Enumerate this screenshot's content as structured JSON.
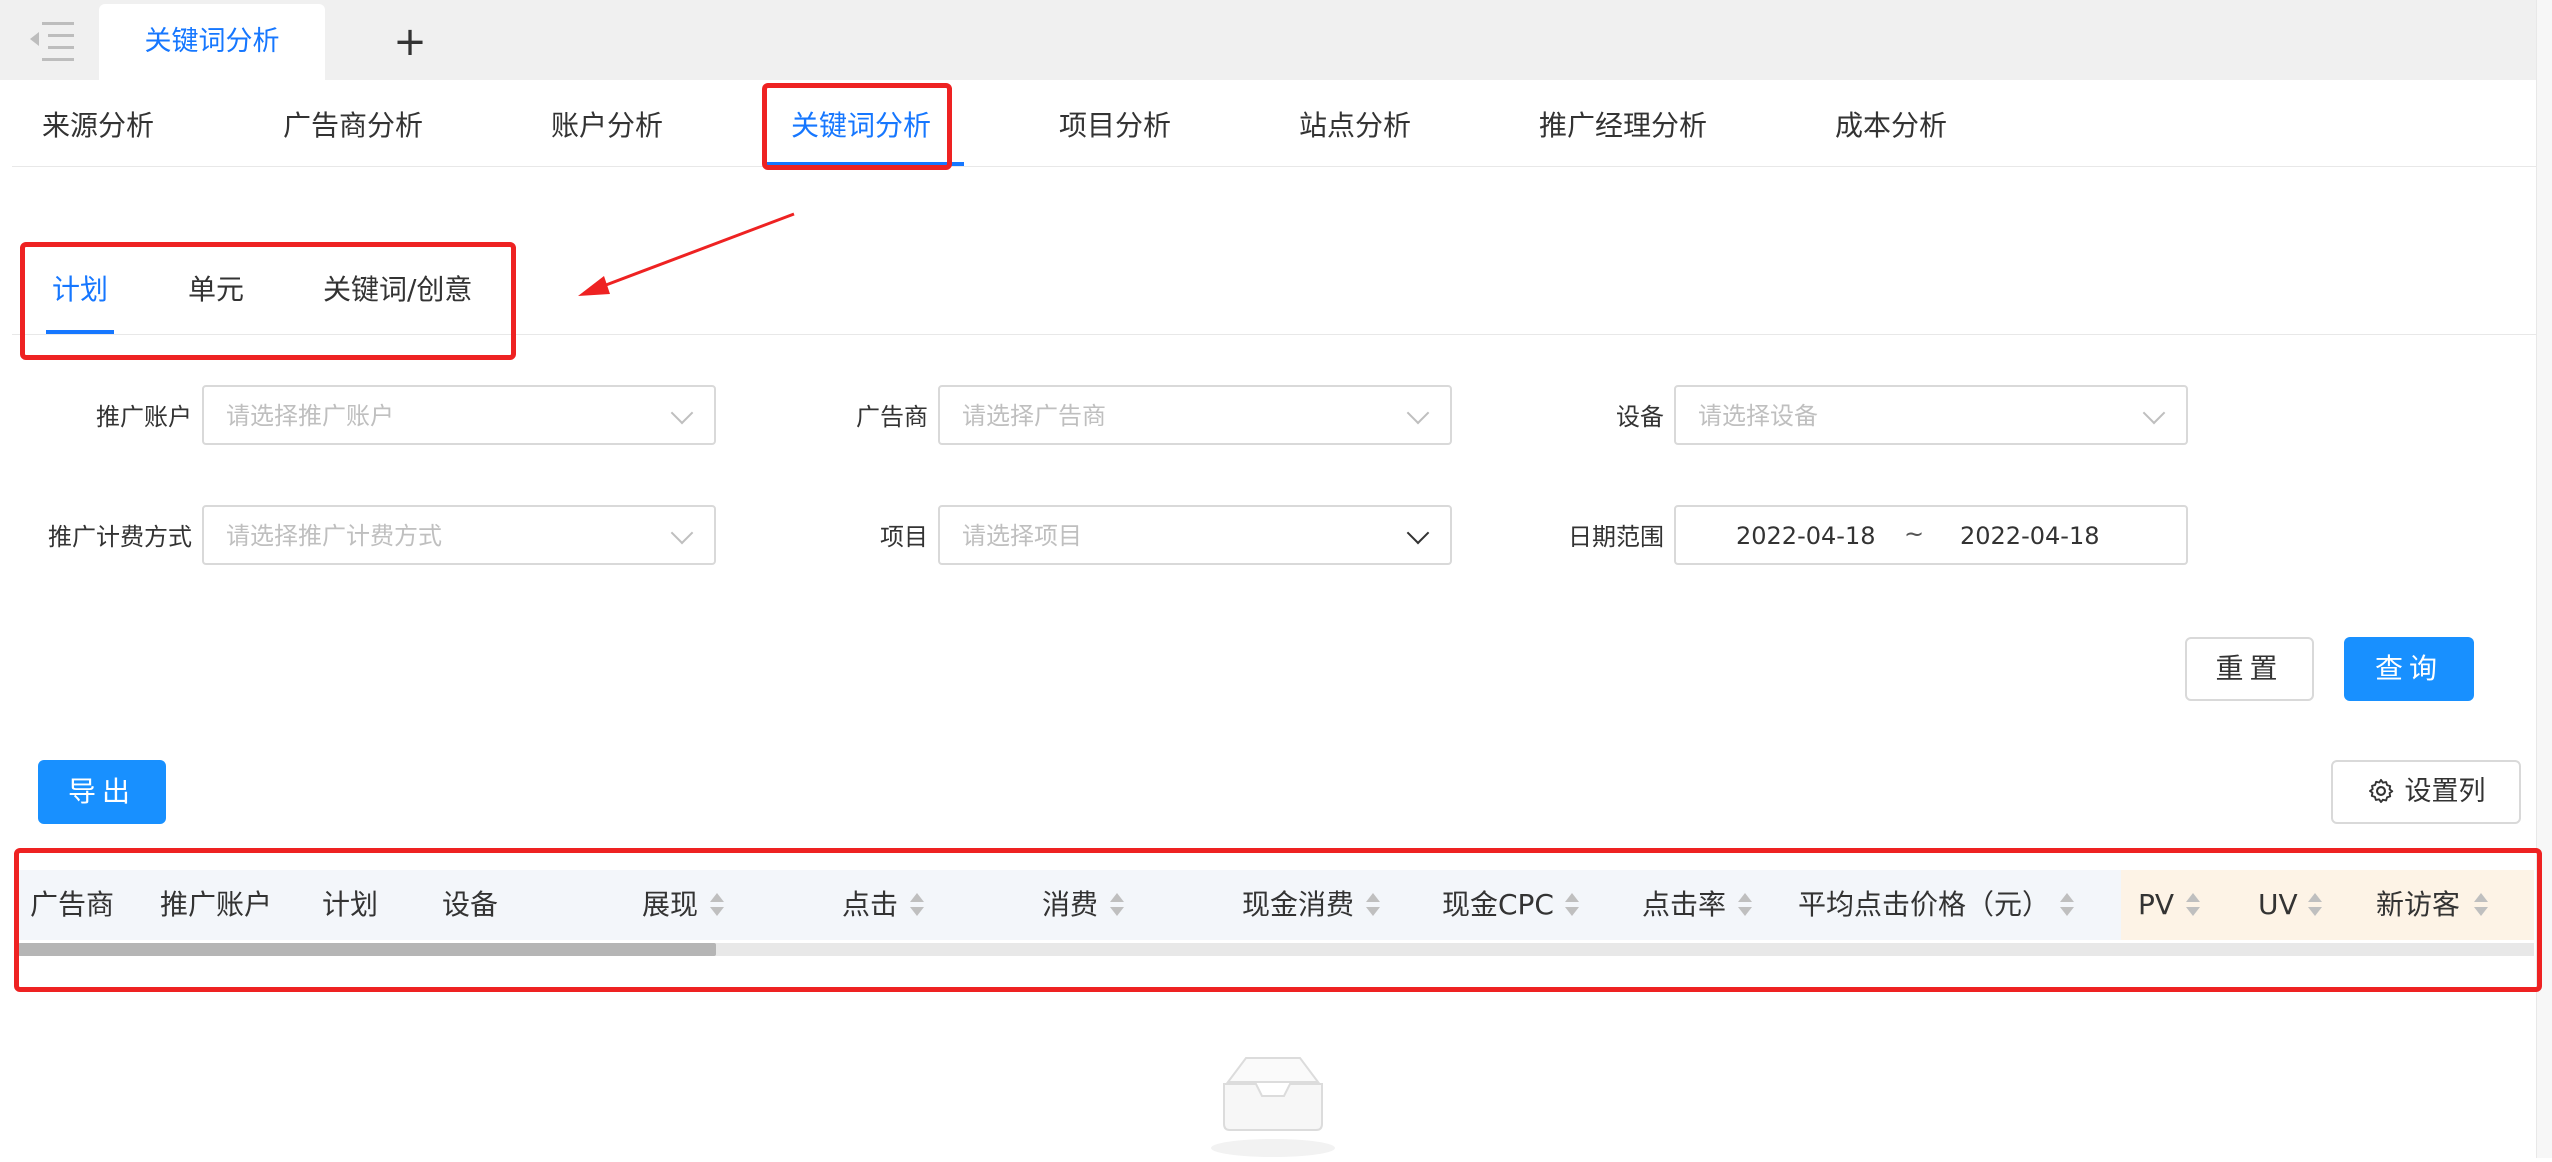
{
  "window_tabs": {
    "active_label": "关键词分析",
    "add_label": "+"
  },
  "analysis_nav": {
    "items": [
      {
        "label": "来源分析"
      },
      {
        "label": "广告商分析"
      },
      {
        "label": "账户分析"
      },
      {
        "label": "关键词分析",
        "active": true
      },
      {
        "label": "项目分析"
      },
      {
        "label": "站点分析"
      },
      {
        "label": "推广经理分析"
      },
      {
        "label": "成本分析"
      }
    ]
  },
  "sub_tabs": {
    "items": [
      {
        "label": "计划",
        "active": true
      },
      {
        "label": "单元"
      },
      {
        "label": "关键词/创意"
      }
    ]
  },
  "filters": {
    "account": {
      "label": "推广账户",
      "placeholder": "请选择推广账户"
    },
    "advertiser": {
      "label": "广告商",
      "placeholder": "请选择广告商"
    },
    "device": {
      "label": "设备",
      "placeholder": "请选择设备"
    },
    "billing": {
      "label": "推广计费方式",
      "placeholder": "请选择推广计费方式"
    },
    "project": {
      "label": "项目",
      "placeholder": "请选择项目"
    },
    "date_range": {
      "label": "日期范围",
      "start": "2022-04-18",
      "separator": "~",
      "end": "2022-04-18"
    }
  },
  "actions": {
    "reset_label": "重置",
    "query_label": "查询",
    "export_label": "导出",
    "columns_label": "设置列"
  },
  "table": {
    "columns": [
      {
        "label": "广告商"
      },
      {
        "label": "推广账户"
      },
      {
        "label": "计划"
      },
      {
        "label": "设备"
      },
      {
        "label": "展现",
        "sortable": true
      },
      {
        "label": "点击",
        "sortable": true
      },
      {
        "label": "消费",
        "sortable": true
      },
      {
        "label": "现金消费",
        "sortable": true
      },
      {
        "label": "现金CPC",
        "sortable": true
      },
      {
        "label": "点击率",
        "sortable": true
      },
      {
        "label": "平均点击价格（元）",
        "sortable": true
      },
      {
        "label": "PV",
        "sortable": true,
        "highlight": true
      },
      {
        "label": "UV",
        "sortable": true,
        "highlight": true
      },
      {
        "label": "新访客",
        "sortable": true,
        "highlight": true
      }
    ],
    "rows": []
  },
  "colors": {
    "primary": "#1677ff",
    "annotation": "#ee2222",
    "header_bg": "#f3f6fa",
    "header_highlight_bg": "#fdf3e6"
  },
  "icons": [
    "menu-fold-icon",
    "plus-icon",
    "chevron-down-icon",
    "gear-icon",
    "sort-icon",
    "empty-inbox-icon"
  ]
}
